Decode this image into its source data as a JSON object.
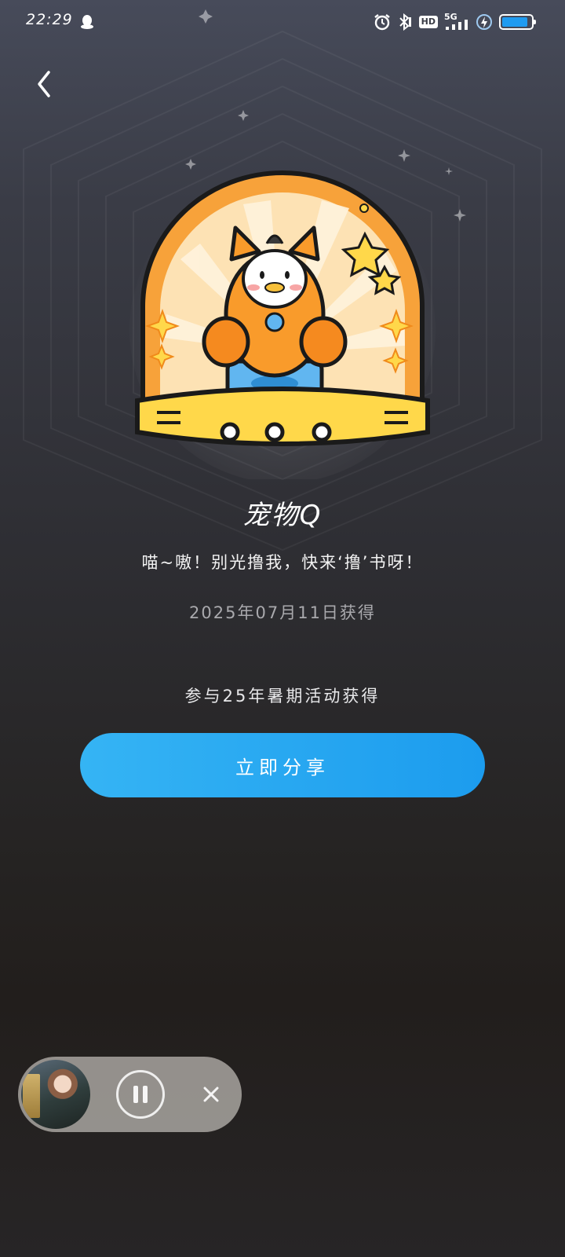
{
  "status_bar": {
    "time": "22:29",
    "network": "5G",
    "hd_label": "HD",
    "battery_level": 0.9
  },
  "badge": {
    "title": "宠物Q",
    "description": "喵~嗷！别光撸我，快来‘撸’书呀！",
    "obtained_date": "2025年07月11日获得",
    "source": "参与25年暑期活动获得"
  },
  "actions": {
    "share_label": "立即分享"
  },
  "colors": {
    "accent": "#1f9bf0",
    "share_gradient_start": "#35b4f4",
    "share_gradient_end": "#1c9cee",
    "badge_orange": "#f7a23a",
    "badge_yellow": "#ffd84a"
  }
}
